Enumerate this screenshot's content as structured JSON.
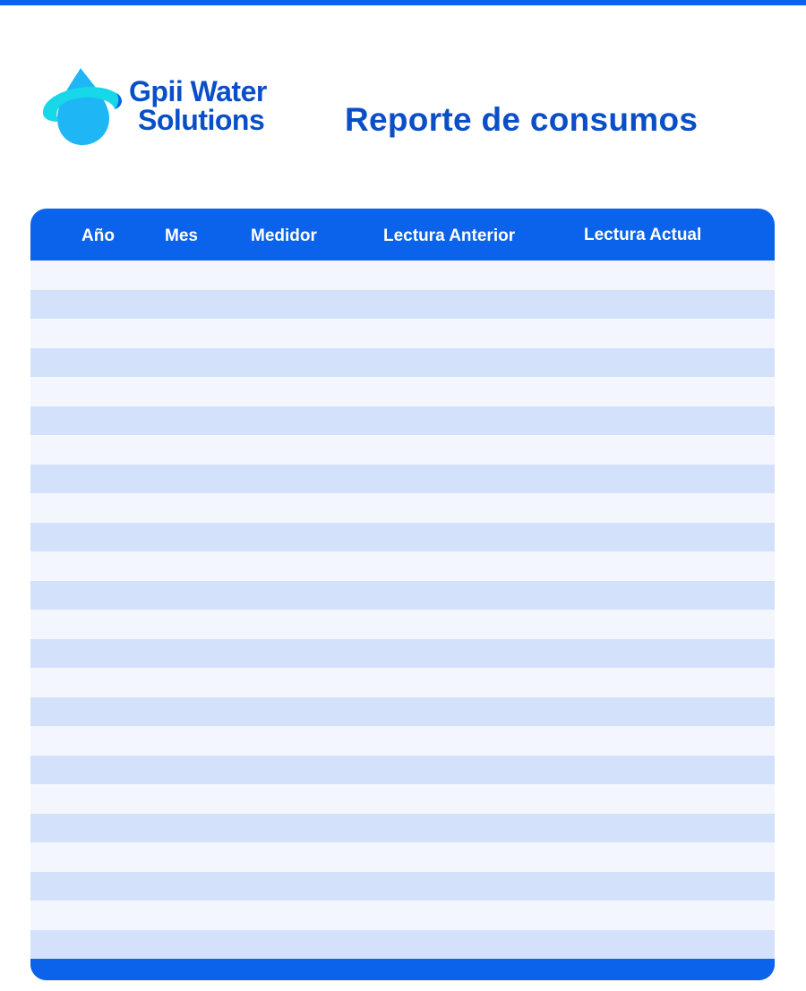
{
  "brand": {
    "name_line1": "Gpii Water",
    "name_line2": "Solutions",
    "colors": {
      "primary": "#0a63ea",
      "dark_blue": "#0a4fc8",
      "drop": "#19b4f5",
      "ring": "#17d6e6"
    }
  },
  "title": "Reporte de consumos",
  "table": {
    "columns": [
      "Año",
      "Mes",
      "Medidor",
      "Lectura Anterior",
      "Lectura Actual"
    ],
    "row_count": 24,
    "row_colors": {
      "odd": "#f3f7fd",
      "even": "#d3e2fa"
    }
  }
}
